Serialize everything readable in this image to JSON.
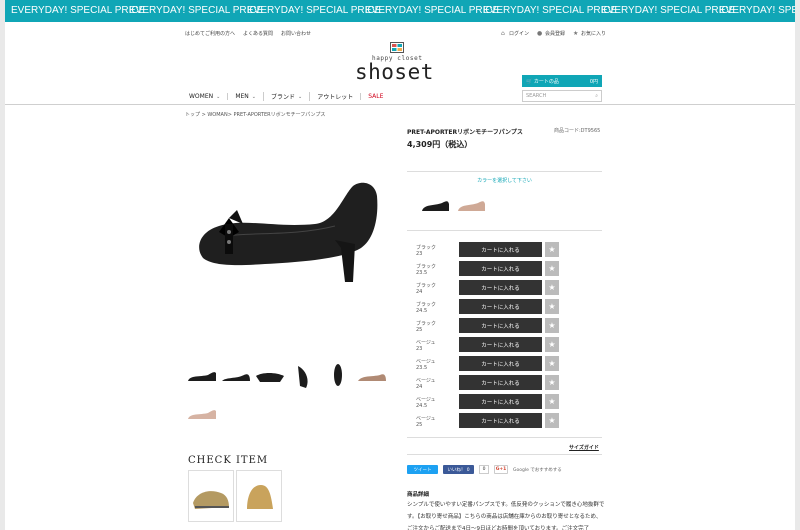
{
  "ticker": [
    "EVERYDAY! SPECIAL PRICE",
    "EVERYDAY! SPECIAL PRICE",
    "EVERYDAY! SPECIAL PRICE",
    "EVERYDAY! SPECIAL PRICE",
    "EVERYDAY! SPECIAL PRICE",
    "EVERYDAY! SPECIAL PRICE",
    "EVERYDAY! SPECIAL PRICE"
  ],
  "util_left": [
    "はじめてご利用の方へ",
    "よくある質問",
    "お問い合わせ"
  ],
  "util_right": {
    "login": "ログイン",
    "register": "会員登録",
    "favorites": "お気に入り"
  },
  "logo": {
    "small": "happy closet",
    "main": "shoset"
  },
  "cart": {
    "label": "カートの品",
    "amount": "0円"
  },
  "search": {
    "placeholder": "SEARCH"
  },
  "nav": [
    "WOMEN",
    "MEN",
    "ブランド",
    "アウトレット",
    "SALE"
  ],
  "breadcrumb": "トップ > WOMAN> PRET-APORTERリボンモチーフパンプス",
  "product": {
    "name": "PRET-APORTERリボンモチーフパンプス",
    "code": "商品コード:DT9565",
    "price": "4,309円（税込）",
    "color_prompt": "カラーを選択して下さい"
  },
  "variants": [
    {
      "color": "ブラック",
      "size": "23"
    },
    {
      "color": "ブラック",
      "size": "23.5"
    },
    {
      "color": "ブラック",
      "size": "24"
    },
    {
      "color": "ブラック",
      "size": "24.5"
    },
    {
      "color": "ブラック",
      "size": "25"
    },
    {
      "color": "ベージュ",
      "size": "23"
    },
    {
      "color": "ベージュ",
      "size": "23.5"
    },
    {
      "color": "ベージュ",
      "size": "24"
    },
    {
      "color": "ベージュ",
      "size": "24.5"
    },
    {
      "color": "ベージュ",
      "size": "25"
    }
  ],
  "add_to_cart_label": "カートに入れる",
  "favorite_icon": "★",
  "size_guide": "サイズガイド",
  "social": {
    "tweet": "ツイート",
    "like": "いいね！ 0",
    "like_count": "0",
    "gplus": "G+1",
    "gplus_text": "Google でおすすめする"
  },
  "check_item_title": "CHECK ITEM",
  "detail": {
    "heading": "商品詳細",
    "body": "シンプルで使いやすい定番パンプスです。低反発のクッションで履き心地抜群です。【お取り寄せ商品】こちらの商品は店舗在庫からのお取り寄せとなるため、ご注文からご配送まで4日〜9日ほどお時間を頂いております。ご注文完了"
  },
  "colors": {
    "accent": "#10a6b6",
    "sale": "#d0021b",
    "button": "#333333",
    "fav": "#bbbbbb"
  }
}
